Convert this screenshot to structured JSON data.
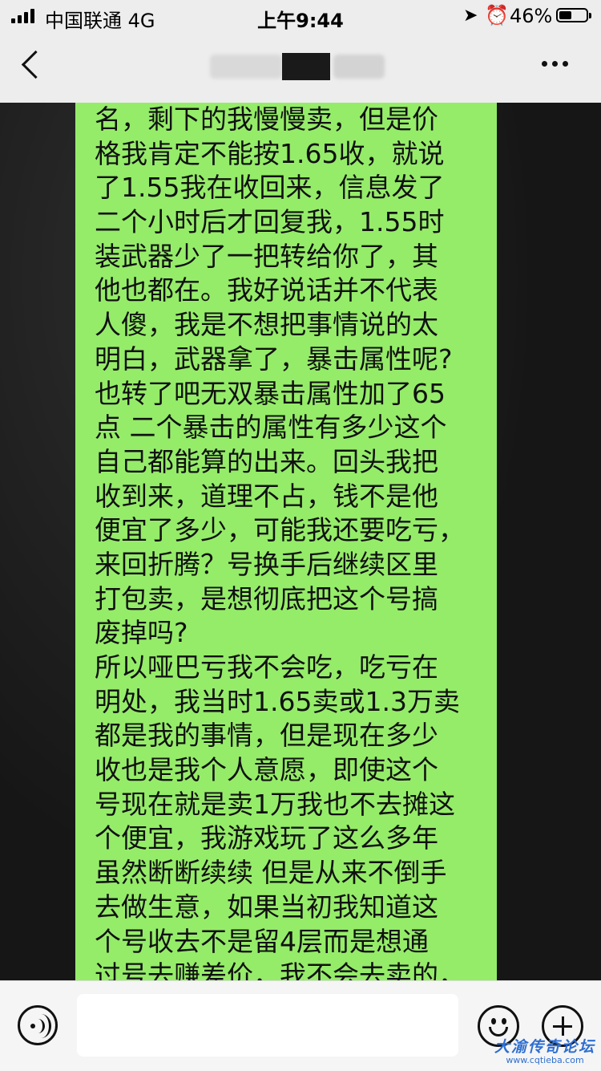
{
  "status_bar": {
    "carrier": "中国联通  4G",
    "time": "上午9:44",
    "battery_percent": "46%",
    "battery_level": 0.46
  },
  "nav": {
    "title": "",
    "back_icon": "chevron-left-icon",
    "more_icon": "ellipsis-icon"
  },
  "message": {
    "bubble_color": "#95ec69",
    "lines": [
      "名，剩下的我慢慢卖，但是价",
      "格我肯定不能按1.65收，就说",
      "了1.55我在收回来，信息发了",
      "二个小时后才回复我，1.55时",
      "装武器少了一把转给你了，其",
      "他也都在。我好说话并不代表",
      "人傻，我是不想把事情说的太",
      "明白，武器拿了，暴击属性呢?",
      "也转了吧无双暴击属性加了65",
      "点 二个暴击的属性有多少这个",
      "自己都能算的出来。回头我把",
      "收到来，道理不占，钱不是他",
      "便宜了多少，可能我还要吃亏，",
      "来回折腾？号换手后继续区里",
      "打包卖，是想彻底把这个号搞",
      "废掉吗?",
      "所以哑巴亏我不会吃，吃亏在",
      "明处，我当时1.65卖或1.3万卖",
      "都是我的事情，但是现在多少",
      "收也是我个人意愿，即使这个",
      "号现在就是卖1万我也不去摊这",
      "个便宜，我游戏玩了这么多年",
      "虽然断断续续 但是从来不倒手",
      "去做生意，如果当初我知道这",
      "个号收去不是留4层而是想通",
      "过号去赚差价，我不会去卖的，"
    ]
  },
  "input_bar": {
    "voice_icon": "voice-icon",
    "emoji_icon": "emoji-icon",
    "plus_icon": "plus-icon",
    "value": ""
  },
  "watermark": {
    "title": "大渝传奇论坛",
    "url": "www.cqtieba.com"
  }
}
